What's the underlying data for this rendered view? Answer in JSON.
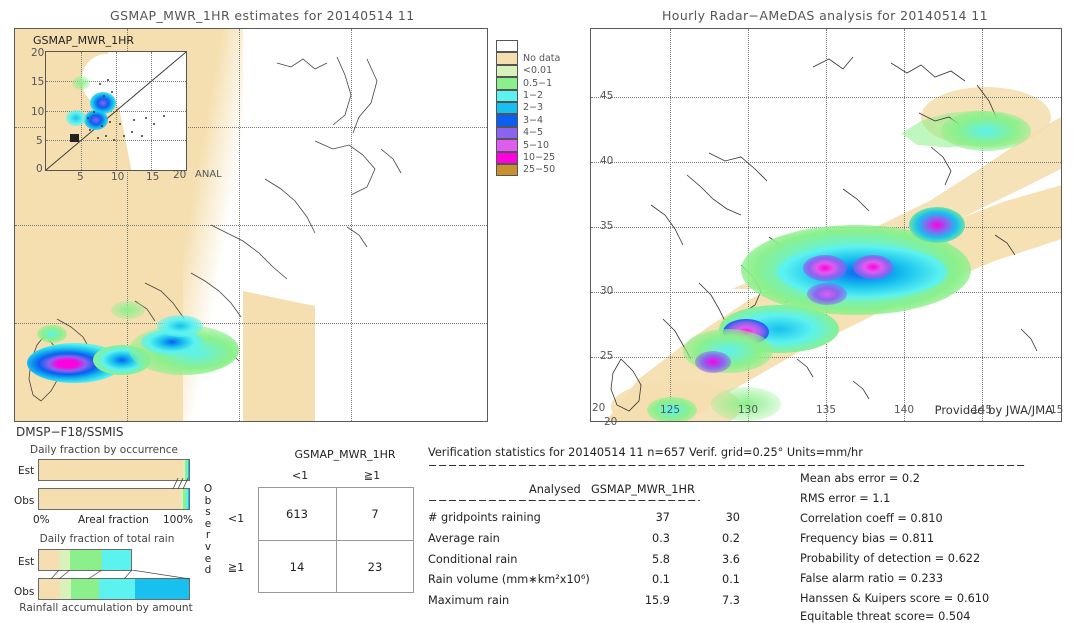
{
  "left_panel": {
    "title": "GSMAP_MWR_1HR estimates for 20140514 11",
    "inset_label": "GSMAP_MWR_1HR",
    "anal_label": "ANAL",
    "sensor_label": "DMSP−F18/SSMIS",
    "inset_y_ticks": [
      "20",
      "15",
      "10",
      "5",
      "0"
    ],
    "inset_x_ticks": [
      "0",
      "5",
      "10",
      "15",
      "20"
    ]
  },
  "right_panel": {
    "title": "Hourly Radar−AMeDAS analysis for 20140514 11",
    "credit": "Provided by JWA/JMA",
    "lat_ticks": [
      "45",
      "40",
      "35",
      "30",
      "25",
      "20"
    ],
    "lon_ticks": [
      "125",
      "130",
      "135",
      "140",
      "145",
      "15"
    ],
    "corner_lon": "20",
    "corner_lon2": "20"
  },
  "colorbar": {
    "bands": [
      {
        "label": "No data",
        "color": "#f5dfb0"
      },
      {
        "label": "<0.01",
        "color": "#d9f2bb"
      },
      {
        "label": "0.5−1",
        "color": "#8bf08b"
      },
      {
        "label": "1−2",
        "color": "#5cf2ef"
      },
      {
        "label": "2−3",
        "color": "#17c0ef"
      },
      {
        "label": "3−4",
        "color": "#0a5ef0"
      },
      {
        "label": "4−5",
        "color": "#8a64f0"
      },
      {
        "label": "5−10",
        "color": "#e05cf0"
      },
      {
        "label": "10−25",
        "color": "#ff00e0"
      },
      {
        "label": "25−50",
        "color": "#c8912f"
      }
    ]
  },
  "fraction_charts": {
    "occurrence": {
      "title": "Daily fraction by occurrence",
      "axis_label": "Areal fraction",
      "axis_min": "0%",
      "axis_max": "100%",
      "rows": [
        {
          "label": "Est",
          "segments": [
            {
              "color": "#f5dfb0",
              "pct": 96.0
            },
            {
              "color": "#d9f2bb",
              "pct": 1.2
            },
            {
              "color": "#8bf08b",
              "pct": 1.6
            },
            {
              "color": "#5cf2ef",
              "pct": 0.7
            },
            {
              "color": "#17c0ef",
              "pct": 0.5
            }
          ]
        },
        {
          "label": "Obs",
          "segments": [
            {
              "color": "#f5dfb0",
              "pct": 94.4
            },
            {
              "color": "#d9f2bb",
              "pct": 1.4
            },
            {
              "color": "#8bf08b",
              "pct": 2.2
            },
            {
              "color": "#5cf2ef",
              "pct": 1.2
            },
            {
              "color": "#17c0ef",
              "pct": 0.8
            }
          ]
        }
      ]
    },
    "total_rain": {
      "title": "Daily fraction of total rain",
      "axis_label": "Rainfall accumulation by amount",
      "rows": [
        {
          "label": "Est",
          "width_pct": 62.0,
          "segments": [
            {
              "color": "#f5dfb0",
              "pct": 22.0
            },
            {
              "color": "#d9f2bb",
              "pct": 12.0
            },
            {
              "color": "#8bf08b",
              "pct": 34.0
            },
            {
              "color": "#5cf2ef",
              "pct": 32.0
            }
          ]
        },
        {
          "label": "Obs",
          "width_pct": 100.0,
          "segments": [
            {
              "color": "#f5dfb0",
              "pct": 14.0
            },
            {
              "color": "#d9f2bb",
              "pct": 7.0
            },
            {
              "color": "#8bf08b",
              "pct": 19.0
            },
            {
              "color": "#5cf2ef",
              "pct": 24.0
            },
            {
              "color": "#17c0ef",
              "pct": 36.0
            }
          ]
        }
      ]
    }
  },
  "contingency": {
    "title": "GSMAP_MWR_1HR",
    "col_headers": [
      "<1",
      "≧1"
    ],
    "row_headers": [
      "<1",
      "≧1"
    ],
    "observed_label": "Observed",
    "cells": [
      [
        "613",
        "7"
      ],
      [
        "14",
        "23"
      ]
    ]
  },
  "verification": {
    "header": "Verification statistics for 20140514 11  n=657  Verif. grid=0.25°  Units=mm/hr",
    "divider": "−−−−−−−−−−−−−−−−−−−−−−−−−−−−−−−−−−−−−−−−−−−−−−−−−−−−−−−−−−−−",
    "col1_header": "Analysed",
    "col2_header": "GSMAP_MWR_1HR",
    "subdivider": "−−−−−−−−−−−−−−−−−−−−−−−−−−−−−−−−−−",
    "rows": [
      {
        "name": "# gridpoints raining",
        "analysed": "37",
        "model": "30"
      },
      {
        "name": "Average rain",
        "analysed": "0.3",
        "model": "0.2"
      },
      {
        "name": "Conditional rain",
        "analysed": "5.8",
        "model": "3.6"
      },
      {
        "name": "Rain volume (mm∗km²x10⁶)",
        "analysed": "0.1",
        "model": "0.1"
      },
      {
        "name": "Maximum rain",
        "analysed": "15.9",
        "model": "7.3"
      }
    ],
    "scores": [
      "Mean abs error = 0.2",
      "RMS error = 1.1",
      "Correlation coeff = 0.810",
      "Frequency bias = 0.811",
      "Probability of detection = 0.622",
      "False alarm ratio = 0.233",
      "Hanssen & Kuipers score = 0.610",
      "Equitable threat score= 0.504"
    ]
  }
}
